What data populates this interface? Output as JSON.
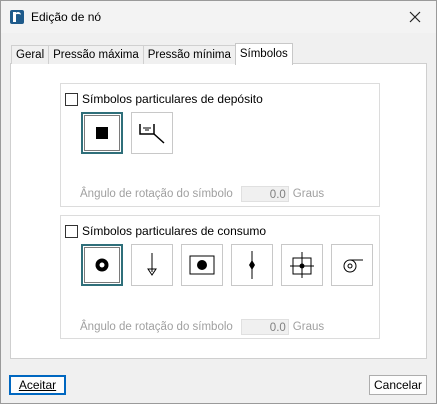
{
  "window": {
    "title": "Edição de nó"
  },
  "tabs": [
    {
      "label": "Geral"
    },
    {
      "label": "Pressão máxima"
    },
    {
      "label": "Pressão mínima"
    },
    {
      "label": "Símbolos",
      "active": true
    }
  ],
  "deposit": {
    "checkbox_label": "Símbolos particulares de depósito",
    "checked": false,
    "angle_label": "Ângulo de rotação do símbolo",
    "angle_value": "0.0",
    "angle_unit": "Graus",
    "symbols": [
      {
        "icon": "filled-square-icon",
        "selected": true
      },
      {
        "icon": "tank-icon",
        "selected": false
      }
    ]
  },
  "consumption": {
    "checkbox_label": "Símbolos particulares de consumo",
    "checked": false,
    "angle_label": "Ângulo de rotação do símbolo",
    "angle_value": "0.0",
    "angle_unit": "Graus",
    "symbols": [
      {
        "icon": "ring-icon",
        "selected": true
      },
      {
        "icon": "down-arrow-icon",
        "selected": false
      },
      {
        "icon": "blob-icon",
        "selected": false
      },
      {
        "icon": "diamond-line-icon",
        "selected": false
      },
      {
        "icon": "crosshair-box-icon",
        "selected": false
      },
      {
        "icon": "spiral-icon",
        "selected": false
      }
    ]
  },
  "footer": {
    "accept_label": "Aceitar",
    "cancel_label": "Cancelar"
  },
  "colors": {
    "selected_border": "#2f6f7a",
    "default_button_border": "#0067c0"
  }
}
